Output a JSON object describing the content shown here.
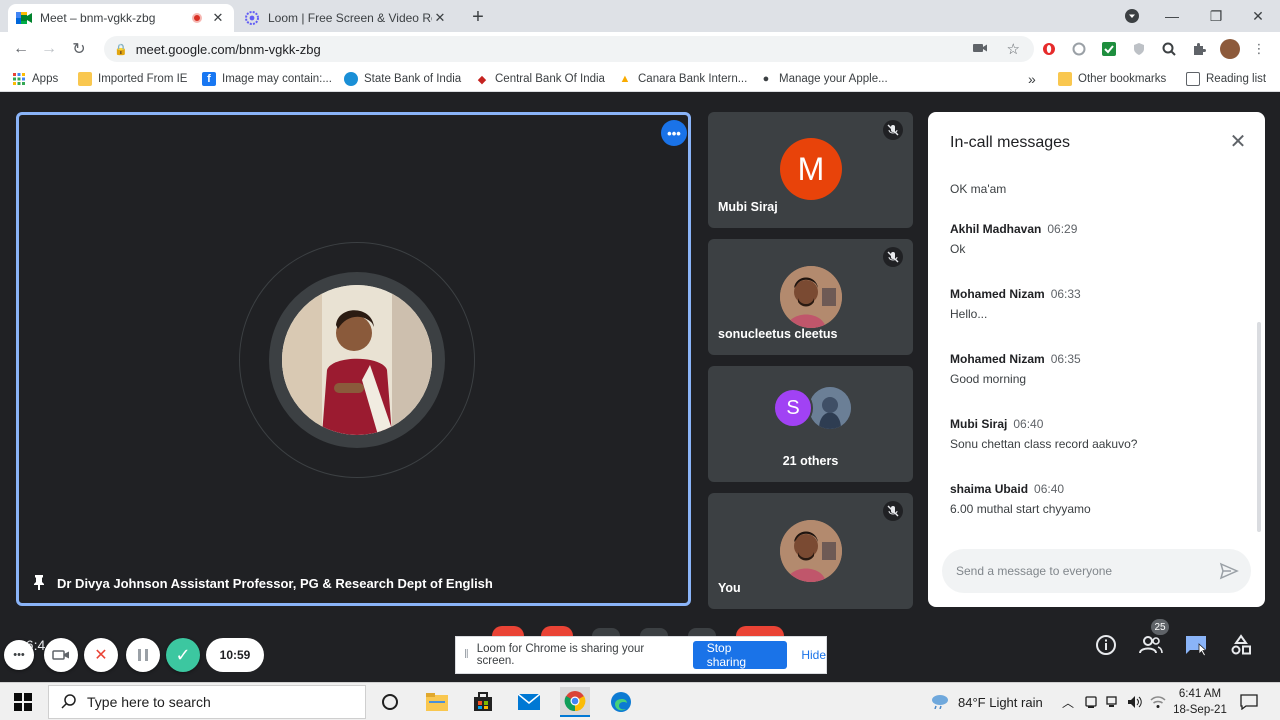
{
  "browser": {
    "tabs": [
      {
        "title": "Meet – bnm-vgkk-zbg",
        "icon": "google-meet-icon",
        "active": true,
        "recording": true
      },
      {
        "title": "Loom | Free Screen & Video Reco",
        "icon": "loom-icon",
        "active": false
      }
    ],
    "url": "meet.google.com/bnm-vgkk-zbg"
  },
  "bookmarks": {
    "items": [
      {
        "label": "Apps",
        "icon": "apps-grid-icon"
      },
      {
        "label": "Imported From IE",
        "icon": "folder-icon"
      },
      {
        "label": "Image may contain:...",
        "icon": "facebook-icon"
      },
      {
        "label": "State Bank of India",
        "icon": "sbi-icon"
      },
      {
        "label": "Central Bank Of India",
        "icon": "central-bank-icon"
      },
      {
        "label": "Canara Bank Intern...",
        "icon": "canara-icon"
      },
      {
        "label": "Manage your Apple...",
        "icon": "apple-icon"
      }
    ],
    "other": "Other bookmarks",
    "reading_list": "Reading list",
    "overflow": "»"
  },
  "meet": {
    "main_speaker": "Dr Divya Johnson Assistant Professor, PG & Research Dept of English",
    "participants": [
      {
        "name": "Mubi Siraj",
        "initial": "M",
        "avatar_color": "#e8430a",
        "muted": true
      },
      {
        "name": "sonucleetus cleetus",
        "muted": true
      },
      {
        "name": "21 others",
        "initial": "S",
        "avatar_color": "#a142f4"
      },
      {
        "name": "You",
        "muted": true
      }
    ],
    "people_count": "25",
    "time_partial": "06:4"
  },
  "chat": {
    "title": "In-call messages",
    "first_text": "OK ma'am",
    "messages": [
      {
        "sender": "Akhil Madhavan",
        "time": "06:29",
        "text": "Ok"
      },
      {
        "sender": "Mohamed Nizam",
        "time": "06:33",
        "text": "Hello..."
      },
      {
        "sender": "Mohamed Nizam",
        "time": "06:35",
        "text": "Good morning"
      },
      {
        "sender": "Mubi Siraj",
        "time": "06:40",
        "text": "Sonu chettan class record aakuvo?"
      },
      {
        "sender": "shaima Ubaid",
        "time": "06:40",
        "text": "6.00 muthal  start chyyamo"
      }
    ],
    "input_placeholder": "Send a message to everyone"
  },
  "loom": {
    "timer": "10:59",
    "share_message": "Loom for Chrome is sharing your screen.",
    "stop_label": "Stop sharing",
    "hide_label": "Hide"
  },
  "taskbar": {
    "search_placeholder": "Type here to search",
    "weather": "84°F  Light rain",
    "time": "6:41 AM",
    "date": "18-Sep-21"
  }
}
